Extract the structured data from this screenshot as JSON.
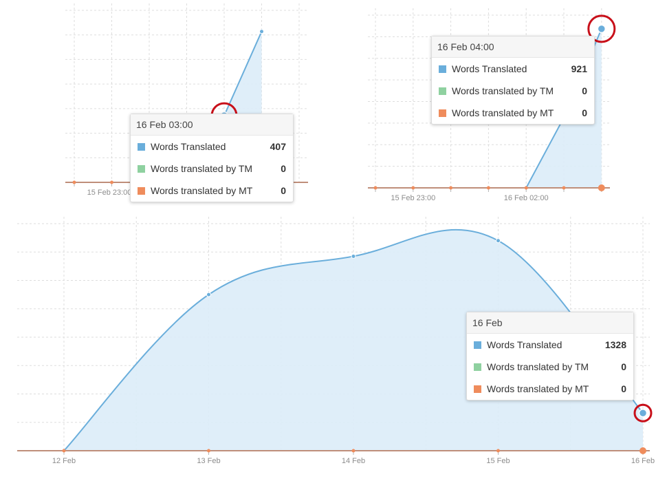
{
  "colors": {
    "words_translated": "#6aaedb",
    "words_translated_by_tm": "#8fd1a0",
    "words_translated_by_mt": "#ef8c5c",
    "area_fill": "#dcecf8",
    "axis": "#bf8e7a",
    "grid": "#dddddd",
    "highlight_ring": "#c8101a"
  },
  "chart_data": [
    {
      "type": "area",
      "x": [
        "15 Feb 23:00",
        "16 Feb 00:00",
        "16 Feb 01:00",
        "16 Feb 02:00",
        "16 Feb 03:00",
        "16 Feb 04:00"
      ],
      "x_tick_labels": [
        "15 Feb 23:00"
      ],
      "series": [
        {
          "name": "Words Translated",
          "values": [
            0,
            0,
            0,
            0,
            407,
            921
          ]
        },
        {
          "name": "Words translated by TM",
          "values": [
            0,
            0,
            0,
            0,
            0,
            0
          ]
        },
        {
          "name": "Words translated by MT",
          "values": [
            0,
            0,
            0,
            0,
            0,
            0
          ]
        }
      ],
      "ylim": [
        0,
        1050
      ],
      "grid": true,
      "tooltip": {
        "title": "16 Feb 03:00",
        "rows": [
          {
            "label": "Words Translated",
            "value": "407"
          },
          {
            "label": "Words translated by TM",
            "value": "0"
          },
          {
            "label": "Words translated by MT",
            "value": "0"
          }
        ]
      }
    },
    {
      "type": "area",
      "x": [
        "15 Feb 22:00",
        "15 Feb 23:00",
        "16 Feb 00:00",
        "16 Feb 01:00",
        "16 Feb 02:00",
        "16 Feb 03:00",
        "16 Feb 04:00"
      ],
      "x_tick_labels": [
        "15 Feb 23:00",
        "16 Feb 02:00"
      ],
      "series": [
        {
          "name": "Words Translated",
          "values": [
            0,
            0,
            0,
            0,
            0,
            407,
            921
          ]
        },
        {
          "name": "Words translated by TM",
          "values": [
            0,
            0,
            0,
            0,
            0,
            0,
            0
          ]
        },
        {
          "name": "Words translated by MT",
          "values": [
            0,
            0,
            0,
            0,
            0,
            0,
            0
          ]
        }
      ],
      "ylim": [
        0,
        1000
      ],
      "grid": true,
      "tooltip": {
        "title": "16 Feb 04:00",
        "rows": [
          {
            "label": "Words Translated",
            "value": "921"
          },
          {
            "label": "Words translated by TM",
            "value": "0"
          },
          {
            "label": "Words translated by MT",
            "value": "0"
          }
        ]
      }
    },
    {
      "type": "area",
      "x": [
        "12 Feb",
        "13 Feb",
        "14 Feb",
        "15 Feb",
        "16 Feb"
      ],
      "x_tick_labels": [
        "12 Feb",
        "13 Feb",
        "14 Feb",
        "15 Feb",
        "16 Feb"
      ],
      "series": [
        {
          "name": "Words Translated",
          "values": [
            0,
            5500,
            6850,
            7400,
            1328
          ]
        },
        {
          "name": "Words translated by TM",
          "values": [
            0,
            0,
            0,
            0,
            0
          ]
        },
        {
          "name": "Words translated by MT",
          "values": [
            0,
            0,
            0,
            0,
            0
          ]
        }
      ],
      "ylim": [
        0,
        8000
      ],
      "grid": true,
      "tooltip": {
        "title": "16 Feb",
        "rows": [
          {
            "label": "Words Translated",
            "value": "1328"
          },
          {
            "label": "Words translated by TM",
            "value": "0"
          },
          {
            "label": "Words translated by MT",
            "value": "0"
          }
        ]
      }
    }
  ]
}
